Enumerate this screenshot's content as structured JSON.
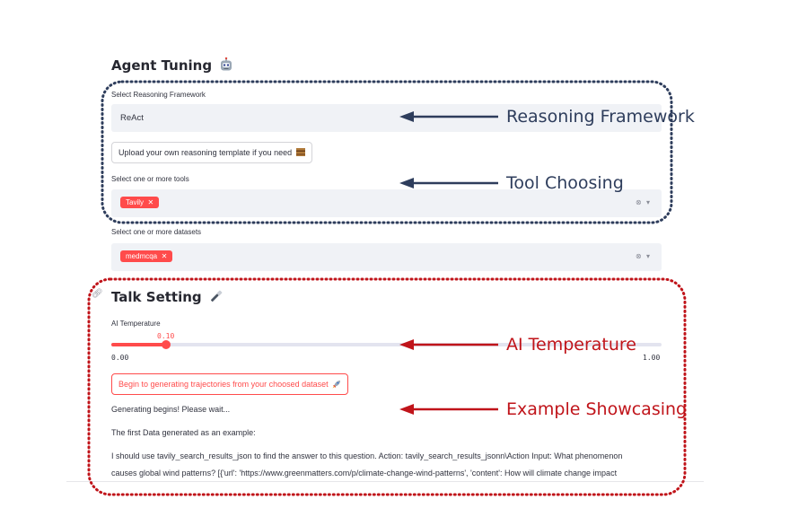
{
  "agent_tuning": {
    "title": "Agent Tuning",
    "title_icon": "robot-icon",
    "framework_label": "Select Reasoning Framework",
    "framework_value": "ReAct",
    "upload_button": "Upload your own reasoning template if you need",
    "upload_icon": "scroll-icon",
    "tools_label": "Select one or more tools",
    "tools_selected": [
      "Tavily"
    ],
    "datasets_label": "Select one or more datasets",
    "datasets_selected": [
      "medmcqa"
    ]
  },
  "talk_setting": {
    "title": "Talk Setting",
    "title_icon": "flashlight-icon",
    "temperature_label": "AI Temperature",
    "temperature_value": "0.10",
    "temperature_min": "0.00",
    "temperature_max": "1.00",
    "temperature_fraction": 0.1,
    "generate_button": "Begin to generating trajectories from your choosed dataset",
    "generate_icon": "rocket-icon",
    "status_text": "Generating begins! Please wait...",
    "example_heading": "The first Data generated as an example:",
    "example_line1": "I should use tavily_search_results_json to find the answer to this question. Action: tavily_search_results_jsonn\\Action Input: What phenomenon",
    "example_line2": "causes global wind patterns? [{'url': 'https://www.greenmatters.com/p/climate-change-wind-patterns', 'content': How will climate change impact"
  },
  "annotations": {
    "reasoning_framework": "Reasoning Framework",
    "tool_choosing": "Tool Choosing",
    "ai_temperature": "AI Temperature",
    "example_showcasing": "Example Showcasing"
  },
  "colors": {
    "accent_red": "#ff4b4b",
    "annotation_blue": "#2e3d5c",
    "annotation_red": "#c0141a",
    "select_bg": "#f0f2f6"
  }
}
